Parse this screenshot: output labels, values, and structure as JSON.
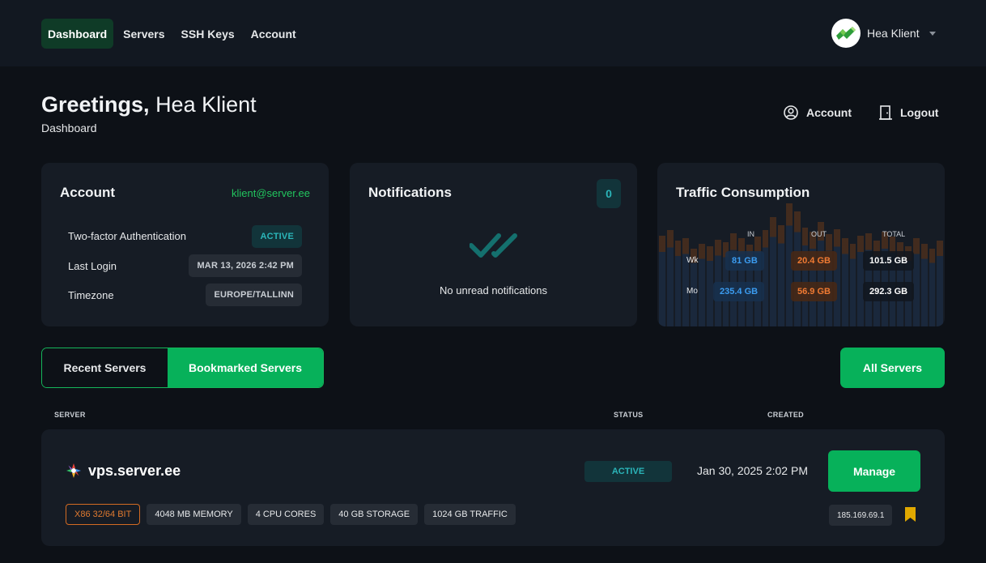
{
  "nav": {
    "items": [
      {
        "label": "Dashboard",
        "active": true
      },
      {
        "label": "Servers",
        "active": false
      },
      {
        "label": "SSH Keys",
        "active": false
      },
      {
        "label": "Account",
        "active": false
      }
    ],
    "user_name": "Hea Klient"
  },
  "header": {
    "greeting": "Greetings,",
    "user_name": "Hea Klient",
    "breadcrumb": "Dashboard",
    "account_label": "Account",
    "logout_label": "Logout"
  },
  "account_card": {
    "title": "Account",
    "email": "klient@server.ee",
    "rows": [
      {
        "label": "Two-factor Authentication",
        "value": "ACTIVE"
      },
      {
        "label": "Last Login",
        "value": "MAR 13, 2026 2:42 PM"
      },
      {
        "label": "Timezone",
        "value": "EUROPE/TALLINN"
      }
    ]
  },
  "notifications_card": {
    "title": "Notifications",
    "count": "0",
    "empty_message": "No unread notifications"
  },
  "traffic_card": {
    "title": "Traffic Consumption",
    "columns": [
      "IN",
      "OUT",
      "TOTAL"
    ],
    "rows": [
      {
        "label": "Wk",
        "in": "81 GB",
        "out": "20.4 GB",
        "total": "101.5 GB"
      },
      {
        "label": "Mo",
        "in": "235.4 GB",
        "out": "56.9 GB",
        "total": "292.3 GB"
      }
    ]
  },
  "tabs": {
    "recent": "Recent Servers",
    "bookmarked": "Bookmarked Servers",
    "all_servers": "All Servers"
  },
  "table": {
    "headers": {
      "server": "SERVER",
      "status": "STATUS",
      "created": "CREATED"
    },
    "servers": [
      {
        "name": "vps.server.ee",
        "status": "ACTIVE",
        "created": "Jan 30, 2025 2:02 PM",
        "manage_label": "Manage",
        "specs": [
          "X86 32/64 BIT",
          "4048 MB MEMORY",
          "4 CPU CORES",
          "40 GB STORAGE",
          "1024 GB TRAFFIC"
        ],
        "ip": "185.169.69.1"
      }
    ]
  },
  "colors": {
    "accent": "#07b15a",
    "status_active": "#2bb5b9",
    "traffic_in": "#3b9cf0",
    "traffic_out": "#f07a32",
    "bookmark": "#e0a800"
  },
  "icons": [
    "avatar-logo-icon",
    "caret-down-icon",
    "user-circle-icon",
    "logout-door-icon",
    "double-check-icon",
    "server-logo-icon",
    "bookmark-icon"
  ]
}
